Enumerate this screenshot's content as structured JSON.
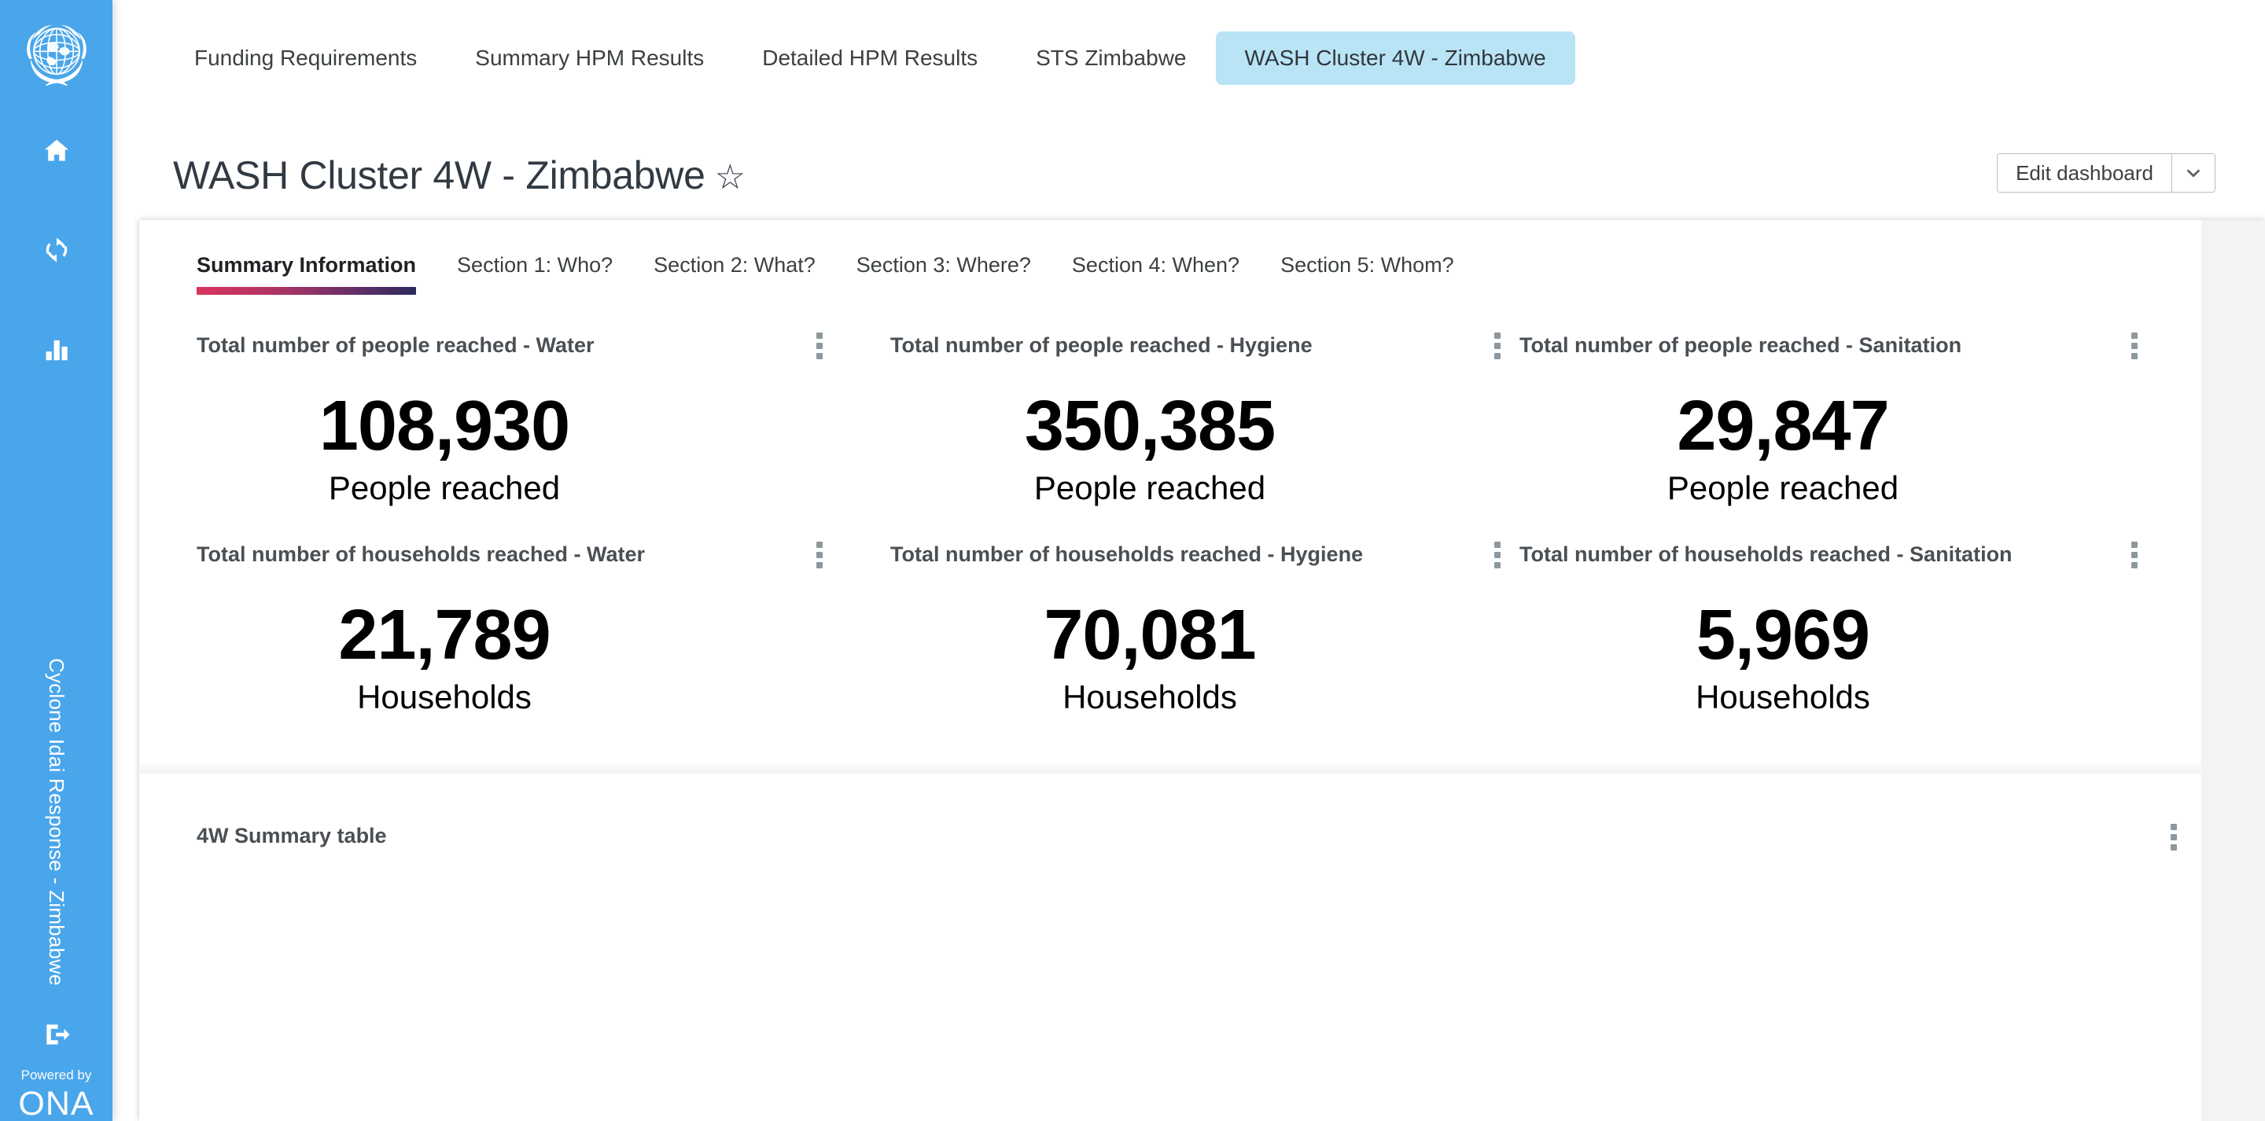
{
  "sidebar": {
    "logo_name": "un-logo",
    "icons": [
      {
        "name": "home-icon"
      },
      {
        "name": "sync-icon"
      },
      {
        "name": "bar-chart-icon"
      },
      {
        "name": "logout-icon"
      }
    ],
    "project_name": "Cyclone Idai Response - Zimbabwe",
    "powered_by": "Powered by",
    "brand": "ONA",
    "background_color": "#4aa6ea"
  },
  "top_tabs": [
    {
      "label": "Funding Requirements",
      "active": false
    },
    {
      "label": "Summary HPM Results",
      "active": false
    },
    {
      "label": "Detailed HPM Results",
      "active": false
    },
    {
      "label": "STS Zimbabwe",
      "active": false
    },
    {
      "label": "WASH Cluster 4W - Zimbabwe",
      "active": true
    }
  ],
  "header": {
    "title": "WASH Cluster 4W - Zimbabwe",
    "favorite_icon": "star-outline-icon",
    "edit_dashboard_label": "Edit dashboard",
    "edit_dashboard_caret_icon": "chevron-down-icon"
  },
  "section_tabs": [
    {
      "label": "Summary Information",
      "active": true
    },
    {
      "label": "Section 1: Who?",
      "active": false
    },
    {
      "label": "Section 2: What?",
      "active": false
    },
    {
      "label": "Section 3: Where?",
      "active": false
    },
    {
      "label": "Section 4: When?",
      "active": false
    },
    {
      "label": "Section 5: Whom?",
      "active": false
    }
  ],
  "active_tab_underline_gradient": [
    "#d9345e",
    "#2d2a5e"
  ],
  "kpi_cards": [
    {
      "title": "Total number of people reached - Water",
      "value": "108,930",
      "label": "People reached",
      "menu_icon": "more-vertical-icon"
    },
    {
      "title": "Total number of people reached - Hygiene",
      "value": "350,385",
      "label": "People reached",
      "menu_icon": "more-vertical-icon"
    },
    {
      "title": "Total number of people reached - Sanitation",
      "value": "29,847",
      "label": "People reached",
      "menu_icon": "more-vertical-icon"
    },
    {
      "title": "Total number of households reached - Water",
      "value": "21,789",
      "label": "Households",
      "menu_icon": "more-vertical-icon"
    },
    {
      "title": "Total number of households reached - Hygiene",
      "value": "70,081",
      "label": "Households",
      "menu_icon": "more-vertical-icon"
    },
    {
      "title": "Total number of households reached - Sanitation",
      "value": "5,969",
      "label": "Households",
      "menu_icon": "more-vertical-icon"
    }
  ],
  "bottom_section": {
    "title": "4W Summary table",
    "menu_icon": "more-vertical-icon"
  }
}
